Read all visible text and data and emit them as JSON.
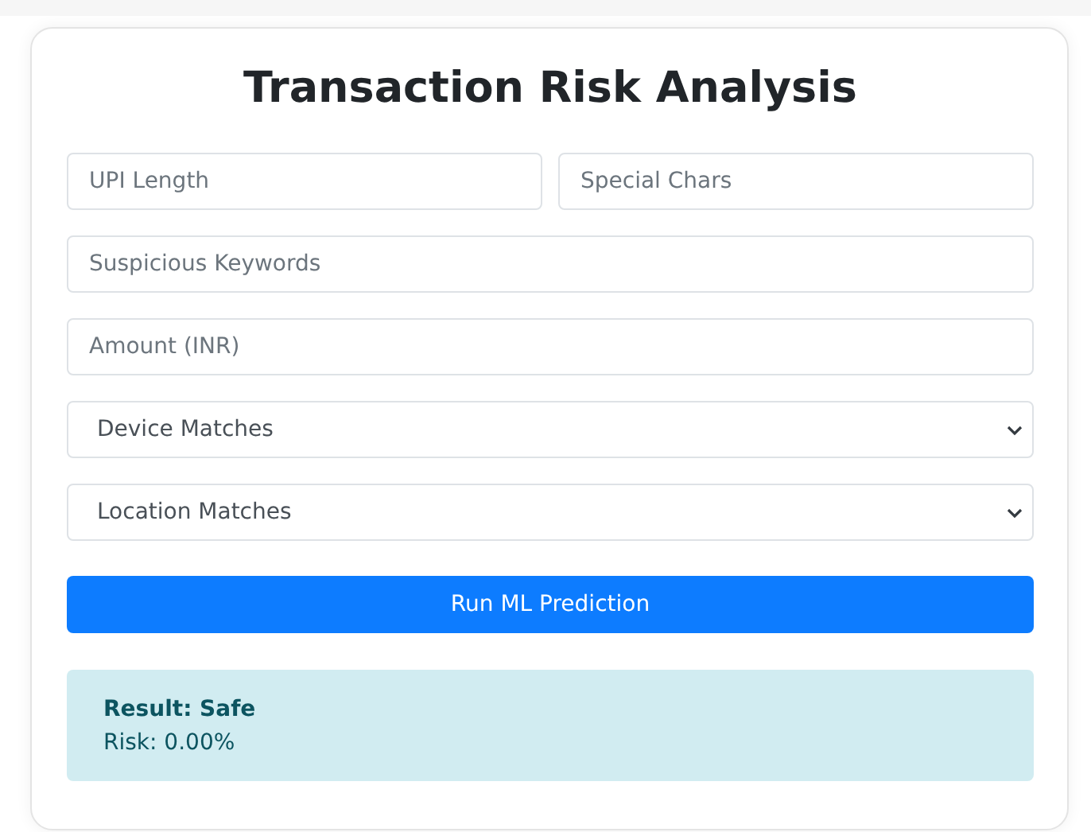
{
  "title": "Transaction Risk Analysis",
  "fields": [
    {
      "kind": "input",
      "placeholder": "UPI Length"
    },
    {
      "kind": "input",
      "placeholder": "Special Chars"
    },
    {
      "kind": "input",
      "placeholder": "Suspicious Keywords"
    },
    {
      "kind": "input",
      "placeholder": "Amount (INR)"
    },
    {
      "kind": "select",
      "value": "Device Matches"
    },
    {
      "kind": "select",
      "value": "Location Matches"
    }
  ],
  "button": "Run ML Prediction",
  "result": {
    "heading": "Result: Safe",
    "risk": "Risk: 0.00%"
  }
}
